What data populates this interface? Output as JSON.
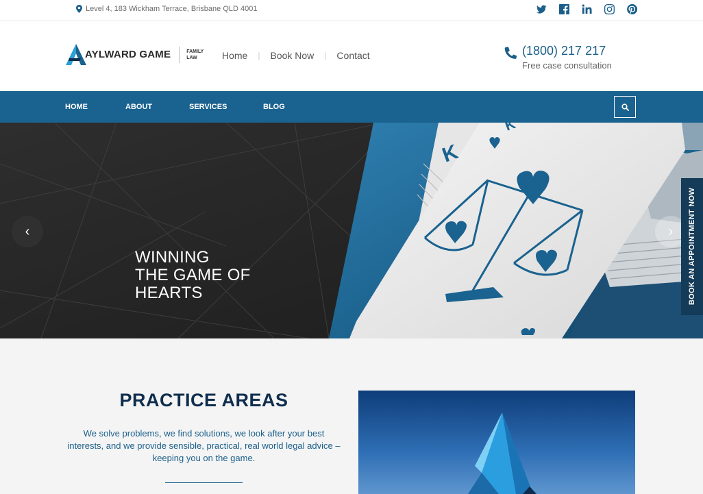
{
  "topbar": {
    "address": "Level 4, 183 Wickham Terrace, Brisbane QLD 4001",
    "social": [
      "twitter-icon",
      "facebook-icon",
      "linkedin-icon",
      "instagram-icon",
      "pinterest-icon"
    ]
  },
  "header": {
    "logo_name": "AYLWARD GAME",
    "logo_sub_1": "FAMILY",
    "logo_sub_2": "LAW",
    "nav": [
      "Home",
      "Book Now",
      "Contact"
    ],
    "phone": "(1800) 217 217",
    "phone_caption": "Free case consultation"
  },
  "mainnav": {
    "items": [
      "HOME",
      "ABOUT",
      "SERVICES",
      "BLOG"
    ]
  },
  "hero": {
    "line1": "WINNING",
    "line2": "THE GAME OF",
    "line3": "HEARTS",
    "prev": "‹",
    "next": "›"
  },
  "book_tab": "BOOK AN APPOINTMENT NOW",
  "practice": {
    "title": "PRACTICE AREAS",
    "description": "We solve problems, we find solutions, we look after your best interests, and we provide sensible, practical, real world legal advice – keeping you on the game."
  },
  "colors": {
    "brand_blue": "#1a628f",
    "dark_navy": "#0f2e4e",
    "tab_navy": "#143b57"
  }
}
